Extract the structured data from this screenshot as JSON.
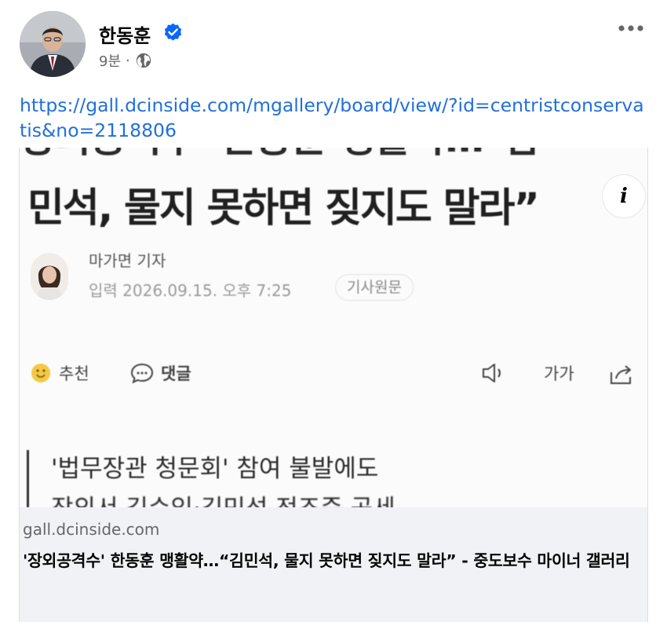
{
  "post": {
    "author": "한동훈",
    "time": "9분",
    "separator": "·",
    "link_text": "https://gall.dcinside.com/mgallery/board/view/?id=centristconservatis&no=2118806"
  },
  "preview": {
    "headline_cut": "장외공격수' 한동훈 맹활약…\"김",
    "headline": "민석, 물지 못하면 짖지도 말라”",
    "info_label": "i",
    "reporter_name": "마가면 기자",
    "dateline": "입력 2026.09.15. 오후 7:25",
    "original_button": "기사원문",
    "actions": {
      "recommend": "추천",
      "comment": "댓글",
      "font_size": "가가"
    },
    "subhead": "'법무장관 청문회' 참여 불발에도",
    "subhead_cut": "장외서 김수익·김민석 전조준 공세"
  },
  "link_card": {
    "domain": "gall.dcinside.com",
    "title": "'장외공격수' 한동훈 맹활약…“김민석, 물지 못하면 짖지도 말라” - 중도보수 마이너 갤러리"
  },
  "icons": {
    "verified": "verified-badge-icon",
    "globe": "globe-icon",
    "more": "more-options-icon",
    "info": "info-icon",
    "recommend": "smile-icon",
    "comment": "comment-icon",
    "speaker": "speaker-icon",
    "font_size": "font-size-icon",
    "share": "share-icon"
  },
  "colors": {
    "link": "#216fdb",
    "verified": "#0866ff",
    "meta_text": "#65676b",
    "card_footer_bg": "#f0f2f5"
  }
}
